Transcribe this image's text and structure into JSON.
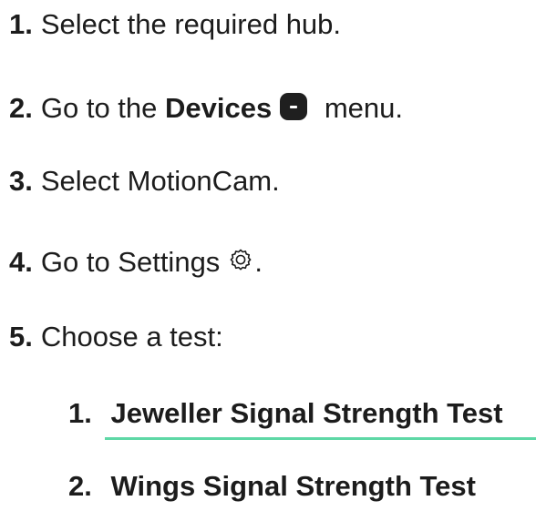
{
  "steps": [
    {
      "number": "1.",
      "text": "Select the required hub."
    },
    {
      "number": "2.",
      "text_before": "Go to the ",
      "bold": "Devices",
      "text_after": " menu.",
      "icon": "devices-icon"
    },
    {
      "number": "3.",
      "text": "Select MotionCam."
    },
    {
      "number": "4.",
      "text": "Go to Settings",
      "icon": "gear-icon",
      "text_after": "."
    },
    {
      "number": "5.",
      "text": "Choose a test:"
    }
  ],
  "tests": [
    {
      "number": "1.",
      "label": "Jeweller Signal Strength Test",
      "link": true,
      "underline_color": "#5ed8a6"
    },
    {
      "number": "2.",
      "label": "Wings Signal Strength Test",
      "link": false
    }
  ]
}
